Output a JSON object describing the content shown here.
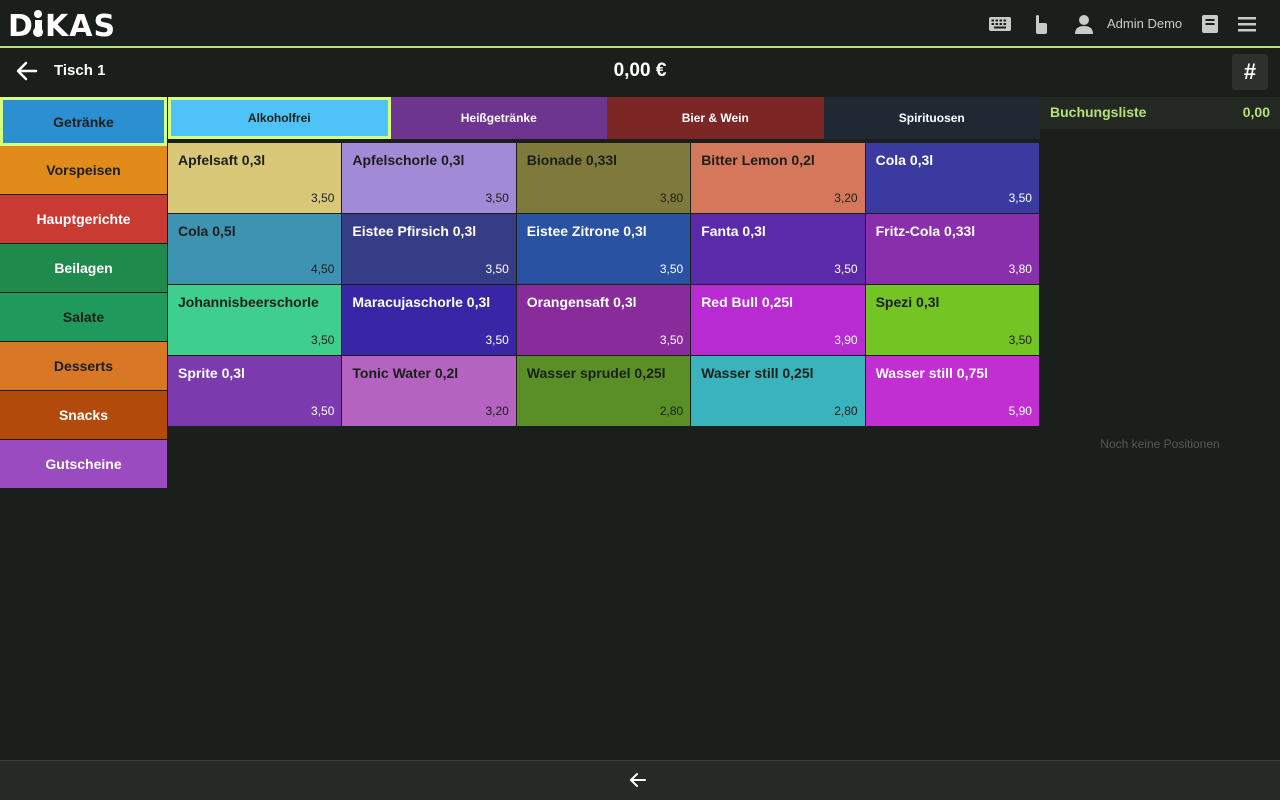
{
  "app": {
    "logo": "DiKAS"
  },
  "header": {
    "user_name": "Admin Demo",
    "icons": [
      "keyboard-icon",
      "touch-icon",
      "user-icon",
      "book-icon",
      "menu-icon"
    ]
  },
  "order": {
    "table_name": "Tisch 1",
    "total": "0,00 €",
    "hash_label": "#"
  },
  "categories": [
    {
      "label": "Getränke",
      "color": "#2b8fd1",
      "active": true,
      "dark": true
    },
    {
      "label": "Vorspeisen",
      "color": "#e18c1a",
      "dark": true
    },
    {
      "label": "Hauptgerichte",
      "color": "#c93a32"
    },
    {
      "label": "Beilagen",
      "color": "#1f8a4b"
    },
    {
      "label": "Salate",
      "color": "#209a5c",
      "dark": true
    },
    {
      "label": "Desserts",
      "color": "#d87826",
      "dark": true
    },
    {
      "label": "Snacks",
      "color": "#b14a0a"
    },
    {
      "label": "Gutscheine",
      "color": "#9a4bc0"
    }
  ],
  "tabs": [
    {
      "label": "Alkoholfrei",
      "color": "#4fc3f7",
      "active": true
    },
    {
      "label": "Heißgetränke",
      "color": "#6d3490"
    },
    {
      "label": "Bier & Wein",
      "color": "#7d2626"
    },
    {
      "label": "Spirituosen",
      "color": "#1f2833"
    }
  ],
  "products": [
    {
      "name": "Apfelsaft 0,3l",
      "price": "3,50",
      "color": "#d8c878",
      "dark": true
    },
    {
      "name": "Apfelschorle 0,3l",
      "price": "3,50",
      "color": "#a18bd6",
      "dark": true
    },
    {
      "name": "Bionade 0,33l",
      "price": "3,80",
      "color": "#7f7a3b",
      "dark": true
    },
    {
      "name": "Bitter Lemon 0,2l",
      "price": "3,20",
      "color": "#d4775a",
      "dark": true
    },
    {
      "name": "Cola 0,3l",
      "price": "3,50",
      "color": "#3b3aa0"
    },
    {
      "name": "Cola 0,5l",
      "price": "4,50",
      "color": "#3e93b2",
      "dark": true
    },
    {
      "name": "Eistee Pfirsich 0,3l",
      "price": "3,50",
      "color": "#363d86"
    },
    {
      "name": "Eistee Zitrone 0,3l",
      "price": "3,50",
      "color": "#2952a3"
    },
    {
      "name": "Fanta 0,3l",
      "price": "3,50",
      "color": "#5b2aa8"
    },
    {
      "name": "Fritz-Cola 0,33l",
      "price": "3,80",
      "color": "#8a2fab"
    },
    {
      "name": "Johannisbeerschorle",
      "price": "3,50",
      "color": "#3ecf8e",
      "dark": true
    },
    {
      "name": "Maracujaschorle 0,3l",
      "price": "3,50",
      "color": "#3826a6"
    },
    {
      "name": "Orangensaft 0,3l",
      "price": "3,50",
      "color": "#8a2b9c"
    },
    {
      "name": "Red Bull 0,25l",
      "price": "3,90",
      "color": "#b82bd3"
    },
    {
      "name": "Spezi 0,3l",
      "price": "3,50",
      "color": "#74c424",
      "dark": true
    },
    {
      "name": "Sprite 0,3l",
      "price": "3,50",
      "color": "#7b3aae"
    },
    {
      "name": "Tonic Water 0,2l",
      "price": "3,20",
      "color": "#b463c0",
      "dark": true
    },
    {
      "name": "Wasser sprudel 0,25l",
      "price": "2,80",
      "color": "#5a8f28",
      "dark": true
    },
    {
      "name": "Wasser still 0,25l",
      "price": "2,80",
      "color": "#39b4bd",
      "dark": true
    },
    {
      "name": "Wasser still 0,75l",
      "price": "5,90",
      "color": "#c12ed2"
    }
  ],
  "booking": {
    "title": "Buchungsliste",
    "sum": "0,00",
    "empty_message": "Noch keine Positionen"
  },
  "colors": {
    "accent": "#b5e07a",
    "highlight_border": "#d6ff7f",
    "background": "#1b1f1b"
  }
}
